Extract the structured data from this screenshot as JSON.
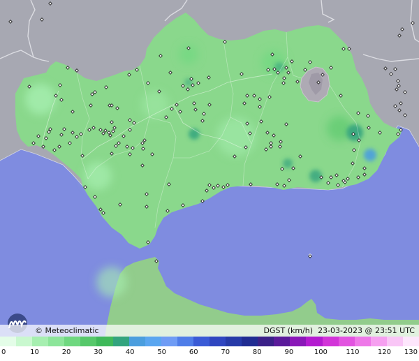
{
  "brand": "© Meteoclimatic",
  "variable": "DGST (km/h)",
  "timestamp": "23-03-2023 @ 23:51 UTC",
  "colors": {
    "sea": "#7f8ce0",
    "land_outside": "#a7a8b2",
    "land_region": "#8ad88c",
    "morocco": "#92cc8c",
    "mountain": "#aeaab4"
  },
  "legend": {
    "ticks": [
      "0",
      "10",
      "20",
      "30",
      "40",
      "50",
      "60",
      "70",
      "80",
      "90",
      "100",
      "110",
      "120",
      "130"
    ],
    "colors": [
      "#e4fde8",
      "#c9f8cf",
      "#a6efb0",
      "#8ce59a",
      "#6fd880",
      "#56c86a",
      "#3fb95a",
      "#33a47e",
      "#4b9ede",
      "#5aa6f0",
      "#6f9cf5",
      "#4f7de8",
      "#3a5bd6",
      "#2f46c0",
      "#263aa8",
      "#202c92",
      "#3a2088",
      "#5a1a9a",
      "#8a18b8",
      "#b41cd0",
      "#d234d8",
      "#e254e0",
      "#ee78e8",
      "#f6a0f0",
      "#f9c6f6",
      "#fde6fc"
    ]
  },
  "stations": [
    [
      15,
      31
    ],
    [
      60,
      28
    ],
    [
      72,
      5
    ],
    [
      42,
      124
    ],
    [
      48,
      205
    ],
    [
      62,
      210
    ],
    [
      78,
      215
    ],
    [
      85,
      210
    ],
    [
      88,
      193
    ],
    [
      66,
      198
    ],
    [
      72,
      185
    ],
    [
      70,
      189
    ],
    [
      55,
      195
    ],
    [
      97,
      97
    ],
    [
      110,
      101
    ],
    [
      86,
      122
    ],
    [
      80,
      137
    ],
    [
      88,
      143
    ],
    [
      92,
      185
    ],
    [
      104,
      190
    ],
    [
      110,
      196
    ],
    [
      100,
      205
    ],
    [
      116,
      192
    ],
    [
      134,
      183
    ],
    [
      128,
      186
    ],
    [
      144,
      186
    ],
    [
      148,
      191
    ],
    [
      151,
      187
    ],
    [
      156,
      190
    ],
    [
      160,
      175
    ],
    [
      164,
      183
    ],
    [
      162,
      188
    ],
    [
      158,
      194
    ],
    [
      170,
      205
    ],
    [
      182,
      210
    ],
    [
      204,
      205
    ],
    [
      207,
      201
    ],
    [
      205,
      213
    ],
    [
      218,
      221
    ],
    [
      190,
      212
    ],
    [
      166,
      209
    ],
    [
      130,
      151
    ],
    [
      136,
      132
    ],
    [
      168,
      155
    ],
    [
      157,
      151
    ],
    [
      186,
      186
    ],
    [
      192,
      176
    ],
    [
      177,
      195
    ],
    [
      212,
      119
    ],
    [
      228,
      131
    ],
    [
      238,
      168
    ],
    [
      246,
      156
    ],
    [
      253,
      150
    ],
    [
      258,
      160
    ],
    [
      278,
      148
    ],
    [
      290,
      173
    ],
    [
      280,
      157
    ],
    [
      292,
      163
    ],
    [
      262,
      123
    ],
    [
      269,
      128
    ],
    [
      276,
      122
    ],
    [
      274,
      113
    ],
    [
      284,
      119
    ],
    [
      299,
      111
    ],
    [
      270,
      69
    ],
    [
      300,
      150
    ],
    [
      196,
      100
    ],
    [
      185,
      107
    ],
    [
      132,
      135
    ],
    [
      152,
      125
    ],
    [
      160,
      151
    ],
    [
      118,
      223
    ],
    [
      122,
      268
    ],
    [
      136,
      282
    ],
    [
      144,
      300
    ],
    [
      148,
      305
    ],
    [
      172,
      293
    ],
    [
      210,
      278
    ],
    [
      210,
      296
    ],
    [
      204,
      237
    ],
    [
      242,
      264
    ],
    [
      240,
      302
    ],
    [
      262,
      294
    ],
    [
      290,
      288
    ],
    [
      296,
      273
    ],
    [
      300,
      265
    ],
    [
      306,
      269
    ],
    [
      312,
      266
    ],
    [
      320,
      268
    ],
    [
      326,
      265
    ],
    [
      336,
      224
    ],
    [
      352,
      211
    ],
    [
      359,
      264
    ],
    [
      374,
      174
    ],
    [
      383,
      190
    ],
    [
      392,
      194
    ],
    [
      388,
      205
    ],
    [
      401,
      210
    ],
    [
      402,
      203
    ],
    [
      388,
      210
    ],
    [
      381,
      214
    ],
    [
      397,
      264
    ],
    [
      407,
      266
    ],
    [
      404,
      242
    ],
    [
      420,
      241
    ],
    [
      430,
      224
    ],
    [
      414,
      258
    ],
    [
      410,
      178
    ],
    [
      354,
      177
    ],
    [
      358,
      191
    ],
    [
      354,
      137
    ],
    [
      364,
      137
    ],
    [
      372,
      142
    ],
    [
      386,
      139
    ],
    [
      372,
      153
    ],
    [
      350,
      148
    ],
    [
      346,
      106
    ],
    [
      384,
      100
    ],
    [
      390,
      78
    ],
    [
      393,
      99
    ],
    [
      398,
      104
    ],
    [
      407,
      112
    ],
    [
      413,
      104
    ],
    [
      418,
      88
    ],
    [
      410,
      97
    ],
    [
      406,
      119
    ],
    [
      426,
      117
    ],
    [
      437,
      100
    ],
    [
      444,
      89
    ],
    [
      456,
      118
    ],
    [
      462,
      107
    ],
    [
      474,
      97
    ],
    [
      488,
      137
    ],
    [
      492,
      70
    ],
    [
      500,
      70
    ],
    [
      513,
      162
    ],
    [
      527,
      166
    ],
    [
      506,
      192
    ],
    [
      528,
      183
    ],
    [
      544,
      190
    ],
    [
      560,
      106
    ],
    [
      552,
      98
    ],
    [
      566,
      99
    ],
    [
      570,
      116
    ],
    [
      571,
      123
    ],
    [
      572,
      158
    ],
    [
      574,
      148
    ],
    [
      580,
      165
    ],
    [
      570,
      192
    ],
    [
      568,
      128
    ],
    [
      576,
      42
    ],
    [
      572,
      51
    ],
    [
      591,
      33
    ],
    [
      580,
      132
    ],
    [
      566,
      152
    ],
    [
      574,
      186
    ],
    [
      514,
      201
    ],
    [
      507,
      215
    ],
    [
      505,
      234
    ],
    [
      522,
      241
    ],
    [
      522,
      250
    ],
    [
      513,
      254
    ],
    [
      494,
      261
    ],
    [
      498,
      256
    ],
    [
      492,
      259
    ],
    [
      460,
      254
    ],
    [
      470,
      262
    ],
    [
      474,
      254
    ],
    [
      482,
      251
    ],
    [
      484,
      265
    ],
    [
      444,
      367
    ],
    [
      224,
      374
    ],
    [
      212,
      347
    ],
    [
      186,
      221
    ],
    [
      160,
      220
    ],
    [
      186,
      172
    ],
    [
      104,
      160
    ],
    [
      322,
      60
    ],
    [
      230,
      80
    ],
    [
      244,
      104
    ]
  ]
}
